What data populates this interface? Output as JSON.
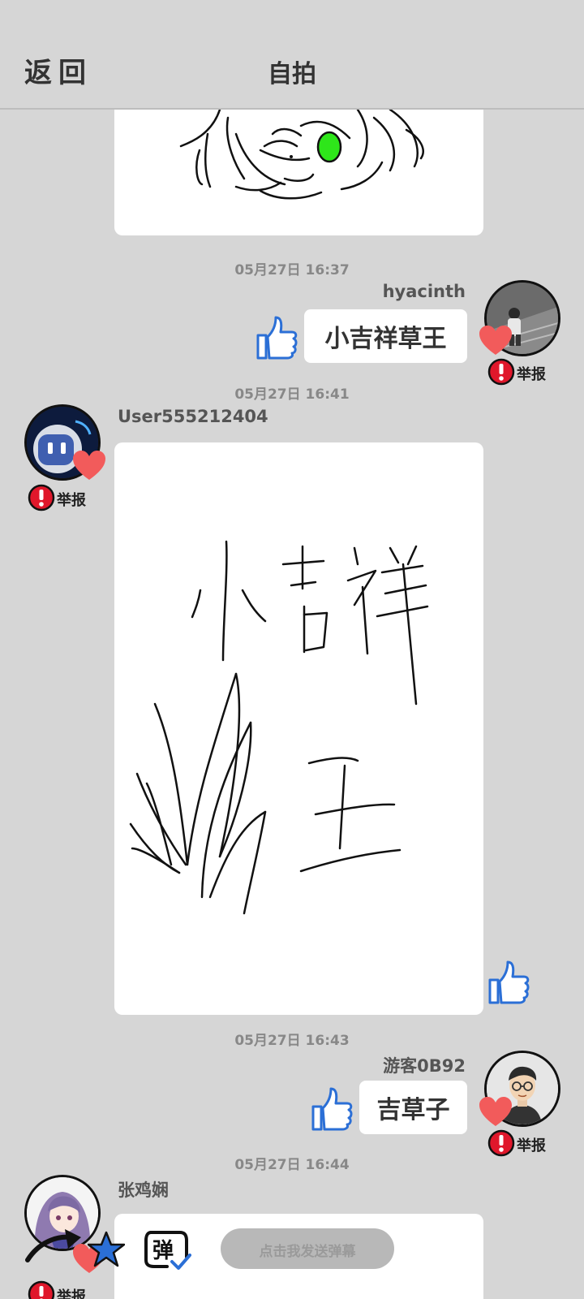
{
  "header": {
    "back_label": "返回",
    "title": "自拍"
  },
  "messages": [
    {
      "timestamp": "05月27日  16:37",
      "username": "hyacinth",
      "text": "小吉祥草王",
      "report": "举报"
    },
    {
      "timestamp": "05月27日  16:41",
      "username": "User555212404",
      "report": "举报",
      "drawing_text": [
        "小吉祥",
        "草",
        "王"
      ]
    },
    {
      "timestamp": "05月27日  16:43",
      "username": "游客0B92",
      "text": "吉草子",
      "report": "举报"
    },
    {
      "timestamp": "05月27日  16:44",
      "username": "张鸡娴",
      "report": "举报"
    }
  ],
  "bottom_bar": {
    "danmu_placeholder": "点击我发送弹幕",
    "danmu_icon_char": "弹"
  },
  "colors": {
    "heart": "#f25b5b",
    "report_red": "#e0172b",
    "like_blue": "#2b6fd6",
    "eye_green": "#2ee61a",
    "background": "#d6d6d6"
  },
  "icons": [
    "heart-icon",
    "report-icon",
    "thumbs-up-icon",
    "star-icon",
    "danmu-icon"
  ]
}
